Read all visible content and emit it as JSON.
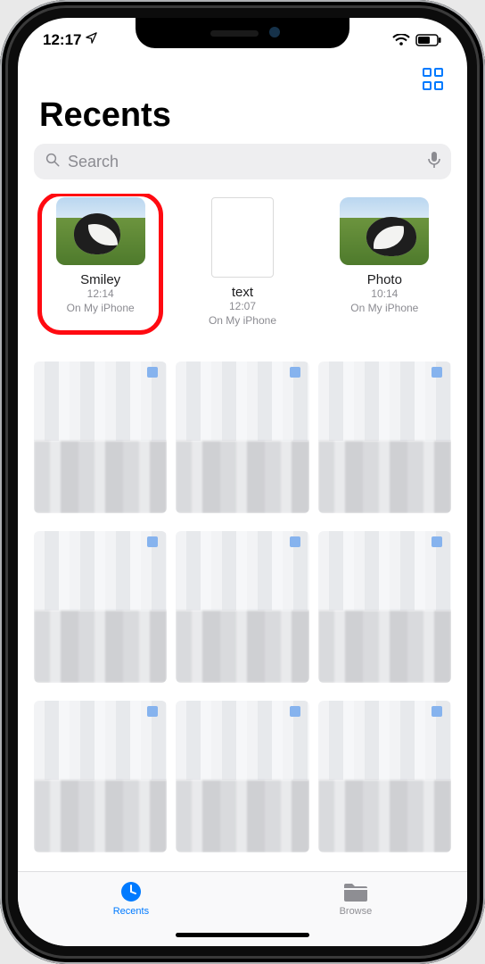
{
  "status": {
    "time": "12:17"
  },
  "header": {
    "title": "Recents"
  },
  "search": {
    "placeholder": "Search"
  },
  "files": [
    {
      "name": "Smiley",
      "time": "12:14",
      "location": "On My iPhone",
      "kind": "photo",
      "highlighted": true
    },
    {
      "name": "text",
      "time": "12:07",
      "location": "On My iPhone",
      "kind": "doc",
      "highlighted": false
    },
    {
      "name": "Photo",
      "time": "10:14",
      "location": "On My iPhone",
      "kind": "photo",
      "highlighted": false
    }
  ],
  "tabs": {
    "recents": "Recents",
    "browse": "Browse",
    "active": "recents"
  }
}
